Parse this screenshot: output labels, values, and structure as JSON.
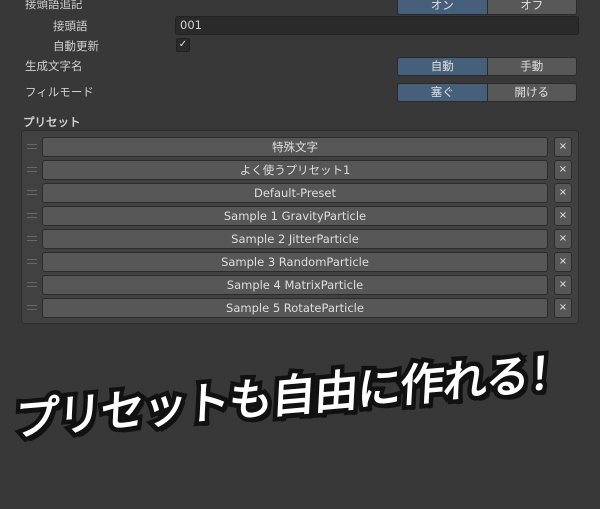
{
  "settings": {
    "prefix_append": {
      "label": "接頭語追記",
      "options": [
        "オン",
        "オフ"
      ],
      "selected": "オン"
    },
    "prefix": {
      "label": "接頭語",
      "value": "001"
    },
    "auto_update": {
      "label": "自動更新",
      "checked": true,
      "check_glyph": "✓"
    },
    "generated_name": {
      "label": "生成文字名",
      "options": [
        "自動",
        "手動"
      ],
      "selected": "自動"
    },
    "fill_mode": {
      "label": "フィルモード",
      "options": [
        "塞ぐ",
        "開ける"
      ],
      "selected": "塞ぐ"
    }
  },
  "presets": {
    "title": "プリセット",
    "delete_glyph": "×",
    "items": [
      "特殊文字",
      "よく使うプリセット1",
      "Default-Preset",
      "Sample 1 GravityParticle",
      "Sample 2 JitterParticle",
      "Sample 3 RandomParticle",
      "Sample 4 MatrixParticle",
      "Sample 5 RotateParticle"
    ]
  },
  "banner": "プリセットも自由に作れる！",
  "colors": {
    "background": "#383838",
    "selected": "#46607c"
  }
}
